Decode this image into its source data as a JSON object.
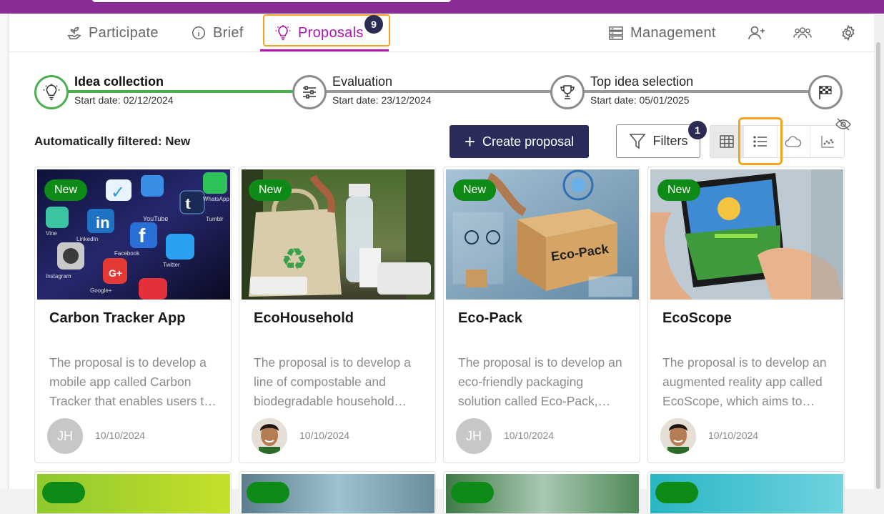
{
  "nav": {
    "tabs": [
      {
        "label": "Participate",
        "icon": "seedling-icon"
      },
      {
        "label": "Brief",
        "icon": "info-icon"
      },
      {
        "label": "Proposals",
        "icon": "lightbulb-icon",
        "badge": "9",
        "active": true
      }
    ],
    "management_label": "Management",
    "right_icons": [
      "add-user-icon",
      "group-icon",
      "gear-icon"
    ]
  },
  "stages": [
    {
      "title": "Idea collection",
      "date": "Start date: 02/12/2024",
      "icon": "lightbulb-icon",
      "current": true
    },
    {
      "title": "Evaluation",
      "date": "Start date: 23/12/2024",
      "icon": "sliders-icon"
    },
    {
      "title": "Top idea selection",
      "date": "Start date: 05/01/2025",
      "icon": "trophy-icon"
    },
    {
      "title": "",
      "date": "",
      "icon": "checkered-flag-icon"
    }
  ],
  "toolbar": {
    "filtered_text": "Automatically filtered: New",
    "create_label": "Create proposal",
    "filters_label": "Filters",
    "filters_badge": "1",
    "views": [
      "grid-icon",
      "list-icon",
      "cloud-icon",
      "scatter-icon"
    ],
    "selected_view": "grid-icon"
  },
  "cards": [
    {
      "tag": "New",
      "title": "Carbon Tracker App",
      "desc": "The proposal is to develop a mobile app called Carbon Tracker that enables users t…",
      "author_initials": "JH",
      "date": "10/10/2024"
    },
    {
      "tag": "New",
      "title": "EcoHousehold",
      "desc": "The proposal is to develop a line of compostable and biodegradable household…",
      "author_initials": "",
      "date": "10/10/2024"
    },
    {
      "tag": "New",
      "title": "Eco-Pack",
      "desc": "The proposal is to develop an eco-friendly packaging solution called Eco-Pack,…",
      "author_initials": "JH",
      "date": "10/10/2024"
    },
    {
      "tag": "New",
      "title": "EcoScope",
      "desc": "The proposal is to develop an augmented reality app called EcoScope, which aims to…",
      "author_initials": "",
      "date": "10/10/2024"
    }
  ],
  "image_text": {
    "card1": [
      "WhatsApp",
      "YouTube",
      "LinkedIn",
      "Facebook",
      "Twitter",
      "Instagram",
      "Google+",
      "Tumblr",
      "Vine"
    ],
    "card3": "Eco-Pack"
  },
  "colors": {
    "topbar": "#8a2c96",
    "accent": "#b015ad",
    "badge": "#2a2c54",
    "new_tag": "#0e8a17",
    "highlight": "#f3a51f",
    "progress": "#4caf50"
  }
}
